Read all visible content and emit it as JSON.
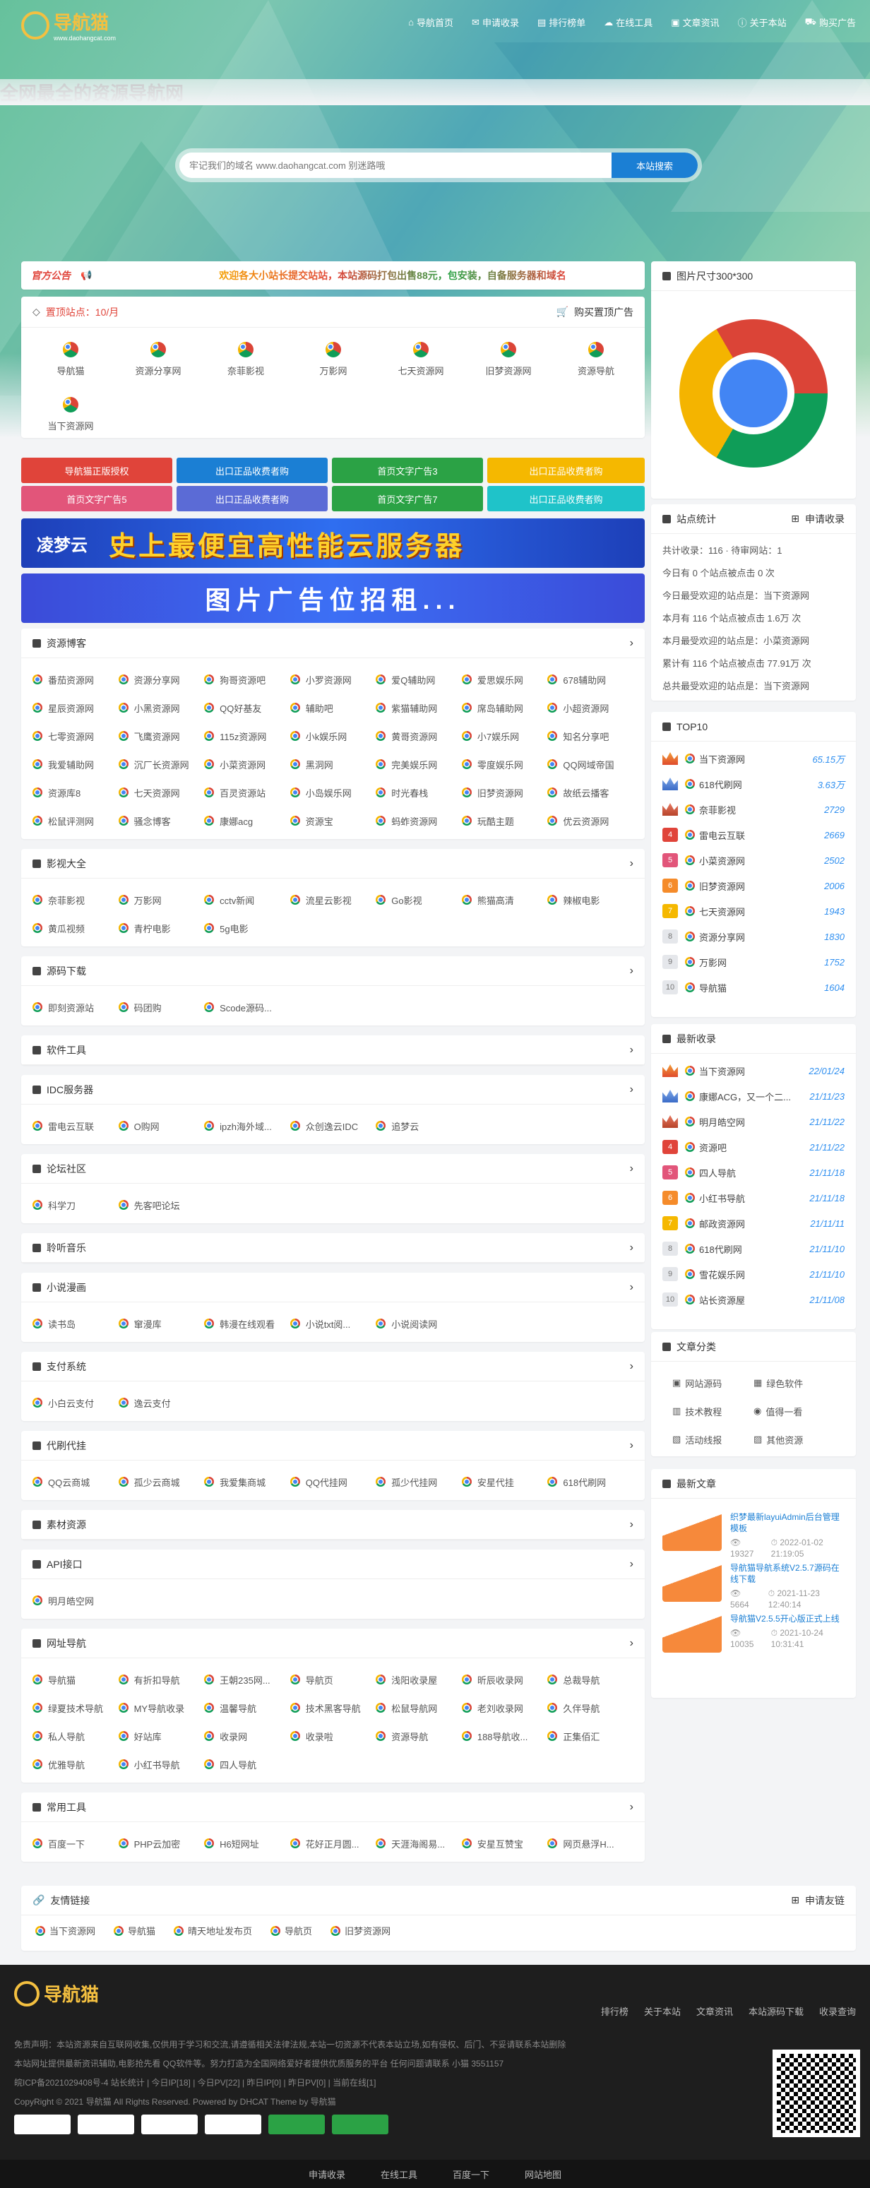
{
  "brand": {
    "name": "导航猫",
    "sub": "www.daohangcat.com"
  },
  "nav": [
    "导航首页",
    "申请收录",
    "排行榜单",
    "在线工具",
    "文章资讯",
    "关于本站",
    "购买广告"
  ],
  "hero_title": "全网最全的资源导航网",
  "search": {
    "placeholder": "牢记我们的域名 www.daohangcat.com 别迷路哦",
    "button": "本站搜索"
  },
  "notice": {
    "label": "官方公告",
    "text": "欢迎各大小站长提交站站，本站源码打包出售88元，包安装，自备服务器和域名"
  },
  "featured": {
    "title": "置顶站点：10/月",
    "buy": "购买置顶广告",
    "items": [
      "导航猫",
      "资源分享网",
      "奈菲影视",
      "万影网",
      "七天资源网",
      "旧梦资源网",
      "资源导航",
      "当下资源网"
    ]
  },
  "buttons": [
    [
      "导航猫正版授权",
      "出口正品收费者购",
      "首页文字广告3",
      "出口正品收费者购"
    ],
    [
      "首页文字广告5",
      "出口正品收费者购",
      "首页文字广告7",
      "出口正品收费者购"
    ]
  ],
  "ad_banner": {
    "brand": "凌梦云",
    "text": "史上最便宜高性能云服务器"
  },
  "ad_banner2": "图片广告位招租...",
  "categories": [
    {
      "title": "资源博客",
      "items": [
        "番茄资源网",
        "资源分享网",
        "狗哥资源吧",
        "小罗资源网",
        "爱Q辅助网",
        "爱思娱乐网",
        "678辅助网",
        "星辰资源网",
        "小黑资源网",
        "QQ好基友",
        "辅助吧",
        "紫猫辅助网",
        "席岛辅助网",
        "小超资源网",
        "七零资源网",
        "飞鹰资源网",
        "115z资源网",
        "小k娱乐网",
        "黄哥资源网",
        "小7娱乐网",
        "知名分享吧",
        "我爱辅助网",
        "沉厂长资源网",
        "小菜资源网",
        "黑洞网",
        "完美娱乐网",
        "零度娱乐网",
        "QQ网域帝国",
        "资源库8",
        "七天资源网",
        "百灵资源站",
        "小岛娱乐网",
        "时光春栈",
        "旧梦资源网",
        "故纸云播客",
        "松鼠评测网",
        "骚念博客",
        "康娜acg",
        "资源宝",
        "蚂蚱资源网",
        "玩酷主题",
        "优云资源网"
      ]
    },
    {
      "title": "影视大全",
      "items": [
        "奈菲影视",
        "万影网",
        "cctv新闻",
        "流星云影视",
        "Go影视",
        "熊猫高清",
        "辣椒电影",
        "黄瓜视频",
        "青柠电影",
        "5g电影"
      ]
    },
    {
      "title": "源码下载",
      "items": [
        "即刻资源站",
        "码团购",
        "Scode源码..."
      ]
    },
    {
      "title": "软件工具",
      "items": []
    },
    {
      "title": "IDC服务器",
      "items": [
        "雷电云互联",
        "O购网",
        "ipzh海外域...",
        "众创逸云IDC",
        "追梦云"
      ]
    },
    {
      "title": "论坛社区",
      "items": [
        "科学刀",
        "先客吧论坛"
      ]
    },
    {
      "title": "聆听音乐",
      "items": []
    },
    {
      "title": "小说漫画",
      "items": [
        "读书岛",
        "窜漫库",
        "韩漫在线观看",
        "小说txt阅...",
        "小说阅读网"
      ]
    },
    {
      "title": "支付系统",
      "items": [
        "小白云支付",
        "逸云支付"
      ]
    },
    {
      "title": "代刷代挂",
      "items": [
        "QQ云商城",
        "孤少云商城",
        "我爱集商城",
        "QQ代挂网",
        "孤少代挂网",
        "安星代挂",
        "618代刷网"
      ]
    },
    {
      "title": "素材资源",
      "items": []
    },
    {
      "title": "API接口",
      "items": [
        "明月皓空网"
      ]
    },
    {
      "title": "网址导航",
      "items": [
        "导航猫",
        "有折扣导航",
        "王朝235网...",
        "导航页",
        "浅阳收录屋",
        "昕辰收录网",
        "总裁导航",
        "绿夏技术导航",
        "MY导航收录",
        "温馨导航",
        "技术黑客导航",
        "松鼠导航网",
        "老刘收录网",
        "久伴导航",
        "私人导航",
        "好站库",
        "收录网",
        "收录啦",
        "资源导航",
        "188导航收...",
        "正集佰汇",
        "优雅导航",
        "小红书导航",
        "四人导航"
      ]
    },
    {
      "title": "常用工具",
      "items": [
        "百度一下",
        "PHP云加密",
        "H6短网址",
        "花好正月圆...",
        "天涯海阁易...",
        "安星互赞宝",
        "网页悬浮H..."
      ]
    }
  ],
  "friends": {
    "title": "友情链接",
    "apply": "申请友链",
    "items": [
      "当下资源网",
      "导航猫",
      "晴天地址发布页",
      "导航页",
      "旧梦资源网"
    ]
  },
  "side_ad": {
    "title": "图片尺寸300*300"
  },
  "stats": {
    "title": "站点统计",
    "apply": "申请收录",
    "lines": [
      "共计收录：116 · 待审网站：1",
      "今日有 0 个站点被点击 0 次",
      "今日最受欢迎的站点是：当下资源网",
      "本月有 116 个站点被点击 1.6万 次",
      "本月最受欢迎的站点是：小菜资源网",
      "累计有 116 个站点被点击 77.91万 次",
      "总共最受欢迎的站点是：当下资源网"
    ]
  },
  "top10": {
    "title": "TOP10",
    "items": [
      [
        "当下资源网",
        "65.15万"
      ],
      [
        "618代刷网",
        "3.63万"
      ],
      [
        "奈菲影视",
        "2729"
      ],
      [
        "雷电云互联",
        "2669"
      ],
      [
        "小菜资源网",
        "2502"
      ],
      [
        "旧梦资源网",
        "2006"
      ],
      [
        "七天资源网",
        "1943"
      ],
      [
        "资源分享网",
        "1830"
      ],
      [
        "万影网",
        "1752"
      ],
      [
        "导航猫",
        "1604"
      ]
    ]
  },
  "latest": {
    "title": "最新收录",
    "items": [
      [
        "当下资源网",
        "22/01/24"
      ],
      [
        "康娜ACG，又一个二...",
        "21/11/23"
      ],
      [
        "明月皓空网",
        "21/11/22"
      ],
      [
        "资源吧",
        "21/11/22"
      ],
      [
        "四人导航",
        "21/11/18"
      ],
      [
        "小红书导航",
        "21/11/18"
      ],
      [
        "邮政资源网",
        "21/11/11"
      ],
      [
        "618代刷网",
        "21/11/10"
      ],
      [
        "雪花娱乐网",
        "21/11/10"
      ],
      [
        "站长资源屋",
        "21/11/08"
      ]
    ]
  },
  "article_cats": {
    "title": "文章分类",
    "items": [
      "网站源码",
      "绿色软件",
      "技术教程",
      "值得一看",
      "活动线报",
      "其他资源"
    ]
  },
  "articles": {
    "title": "最新文章",
    "items": [
      {
        "title": "织梦最新layuiAdmin后台管理模板",
        "views": "19327",
        "date": "2022-01-02 21:19:05"
      },
      {
        "title": "导航猫导航系统V2.5.7源码在线下载",
        "views": "5664",
        "date": "2021-11-23 12:40:14"
      },
      {
        "title": "导航猫V2.5.5开心版正式上线",
        "views": "10035",
        "date": "2021-10-24 10:31:41"
      }
    ]
  },
  "footer": {
    "links": [
      "排行榜",
      "关于本站",
      "文章资讯",
      "本站源码下载",
      "收录查询"
    ],
    "line1": "免责声明：本站资源来自互联网收集,仅供用于学习和交流,请遵循相关法律法规,本站一切资源不代表本站立场,如有侵权、后门、不妥请联系本站删除",
    "line2": "本站网址提供最新资讯辅助,电影抢先看 QQ软件等。努力打造为全国网络爱好者提供优质服务的平台 任何问题请联系 小猫",
    "qq": "3551157",
    "line3": "皖ICP备2021029408号-4 站长统计 | 今日IP[18] | 今日PV[22] | 昨日IP[0] | 昨日PV[0] | 当前在线[1]",
    "copyright": "CopyRight © 2021 导航猫 All Rights Reserved. Powered by DHCAT Theme by 导航猫",
    "bottom": [
      "申请收录",
      "在线工具",
      "百度一下",
      "网站地图"
    ]
  },
  "colors": {
    "blue": "#1b7fd4",
    "red": "#e0443a",
    "green": "#2ba245",
    "yellow": "#f5b800",
    "cyan": "#1fc3c9",
    "purple": "#5b6bd6",
    "pink": "#e2557a"
  }
}
